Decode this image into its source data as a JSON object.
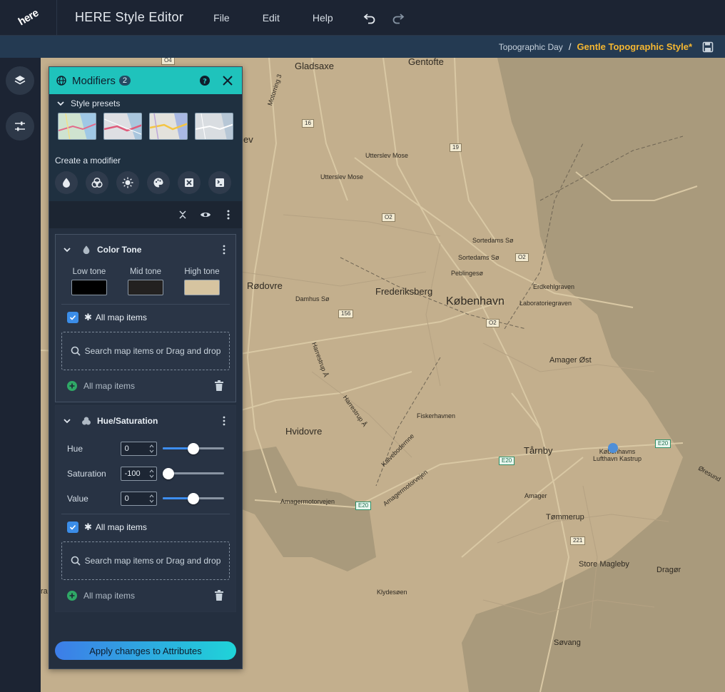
{
  "app": {
    "title": "HERE Style Editor",
    "logo_text": "here",
    "menu": [
      {
        "label": "File"
      },
      {
        "label": "Edit"
      },
      {
        "label": "Help"
      }
    ]
  },
  "breadcrumb": {
    "parent": "Topographic Day",
    "separator": "/",
    "current": "Gentle Topographic Style*"
  },
  "colors": {
    "accent": "#1fc3bc",
    "highlight": "#f5b731",
    "map_land": "#c3af8d",
    "checkbox": "#3b8de8"
  },
  "panel": {
    "title": "Modifiers",
    "count": "2",
    "presets_label": "Style presets",
    "create_label": "Create a modifier",
    "tools": [
      {
        "icon": "color-tone-icon"
      },
      {
        "icon": "hue-saturation-icon"
      },
      {
        "icon": "brightness-icon"
      },
      {
        "icon": "palette-icon"
      },
      {
        "icon": "remove-icon"
      },
      {
        "icon": "script-icon"
      }
    ],
    "apply_label": "Apply changes to Attributes"
  },
  "color_tone": {
    "title": "Color Tone",
    "tones": [
      {
        "label": "Low tone",
        "color": "#000000"
      },
      {
        "label": "Mid tone",
        "color": "#232120"
      },
      {
        "label": "High tone",
        "color": "#d6c4a0"
      }
    ],
    "all_items_label": "All map items",
    "dropzone_text": "Search map items or Drag and drop",
    "footer_label": "All map items"
  },
  "hue_saturation": {
    "title": "Hue/Saturation",
    "sliders": [
      {
        "label": "Hue",
        "value": "0",
        "level": 0.5
      },
      {
        "label": "Saturation",
        "value": "-100",
        "level": 0.0
      },
      {
        "label": "Value",
        "value": "0",
        "level": 0.5
      }
    ],
    "all_items_label": "All map items",
    "dropzone_text": "Search map items or Drag and drop",
    "footer_label": "All map items"
  },
  "map": {
    "labels": [
      "Gladsaxe",
      "Gentofte",
      "Utterslev Mose",
      "Utterslev Mose",
      "Sortedams Sø",
      "Sortedams Sø",
      "Peblingesø",
      "Rødovre",
      "Damhus Sø",
      "Frederiksberg",
      "København",
      "Erdkehlgraven",
      "Laboratoriegraven",
      "Amager Øst",
      "Hvidovre",
      "Fiskerhavnen",
      "Tårnby",
      "Københavns Lufthavn Kastrup",
      "Amager",
      "Tømmerup",
      "Store Magleby",
      "Dragør",
      "Klydesøen",
      "Søvang",
      "Amagermotorvejen",
      "Amagermotorvejen",
      "Kalvebodernne",
      "Motorring 3",
      "Harrestrup Å",
      "Harrestrup Å",
      "Øresund",
      "ev",
      "ra"
    ],
    "shields": [
      "16",
      "19",
      "O2",
      "O2",
      "O2",
      "156",
      "E20",
      "E20",
      "E20",
      "221",
      "O4"
    ]
  }
}
